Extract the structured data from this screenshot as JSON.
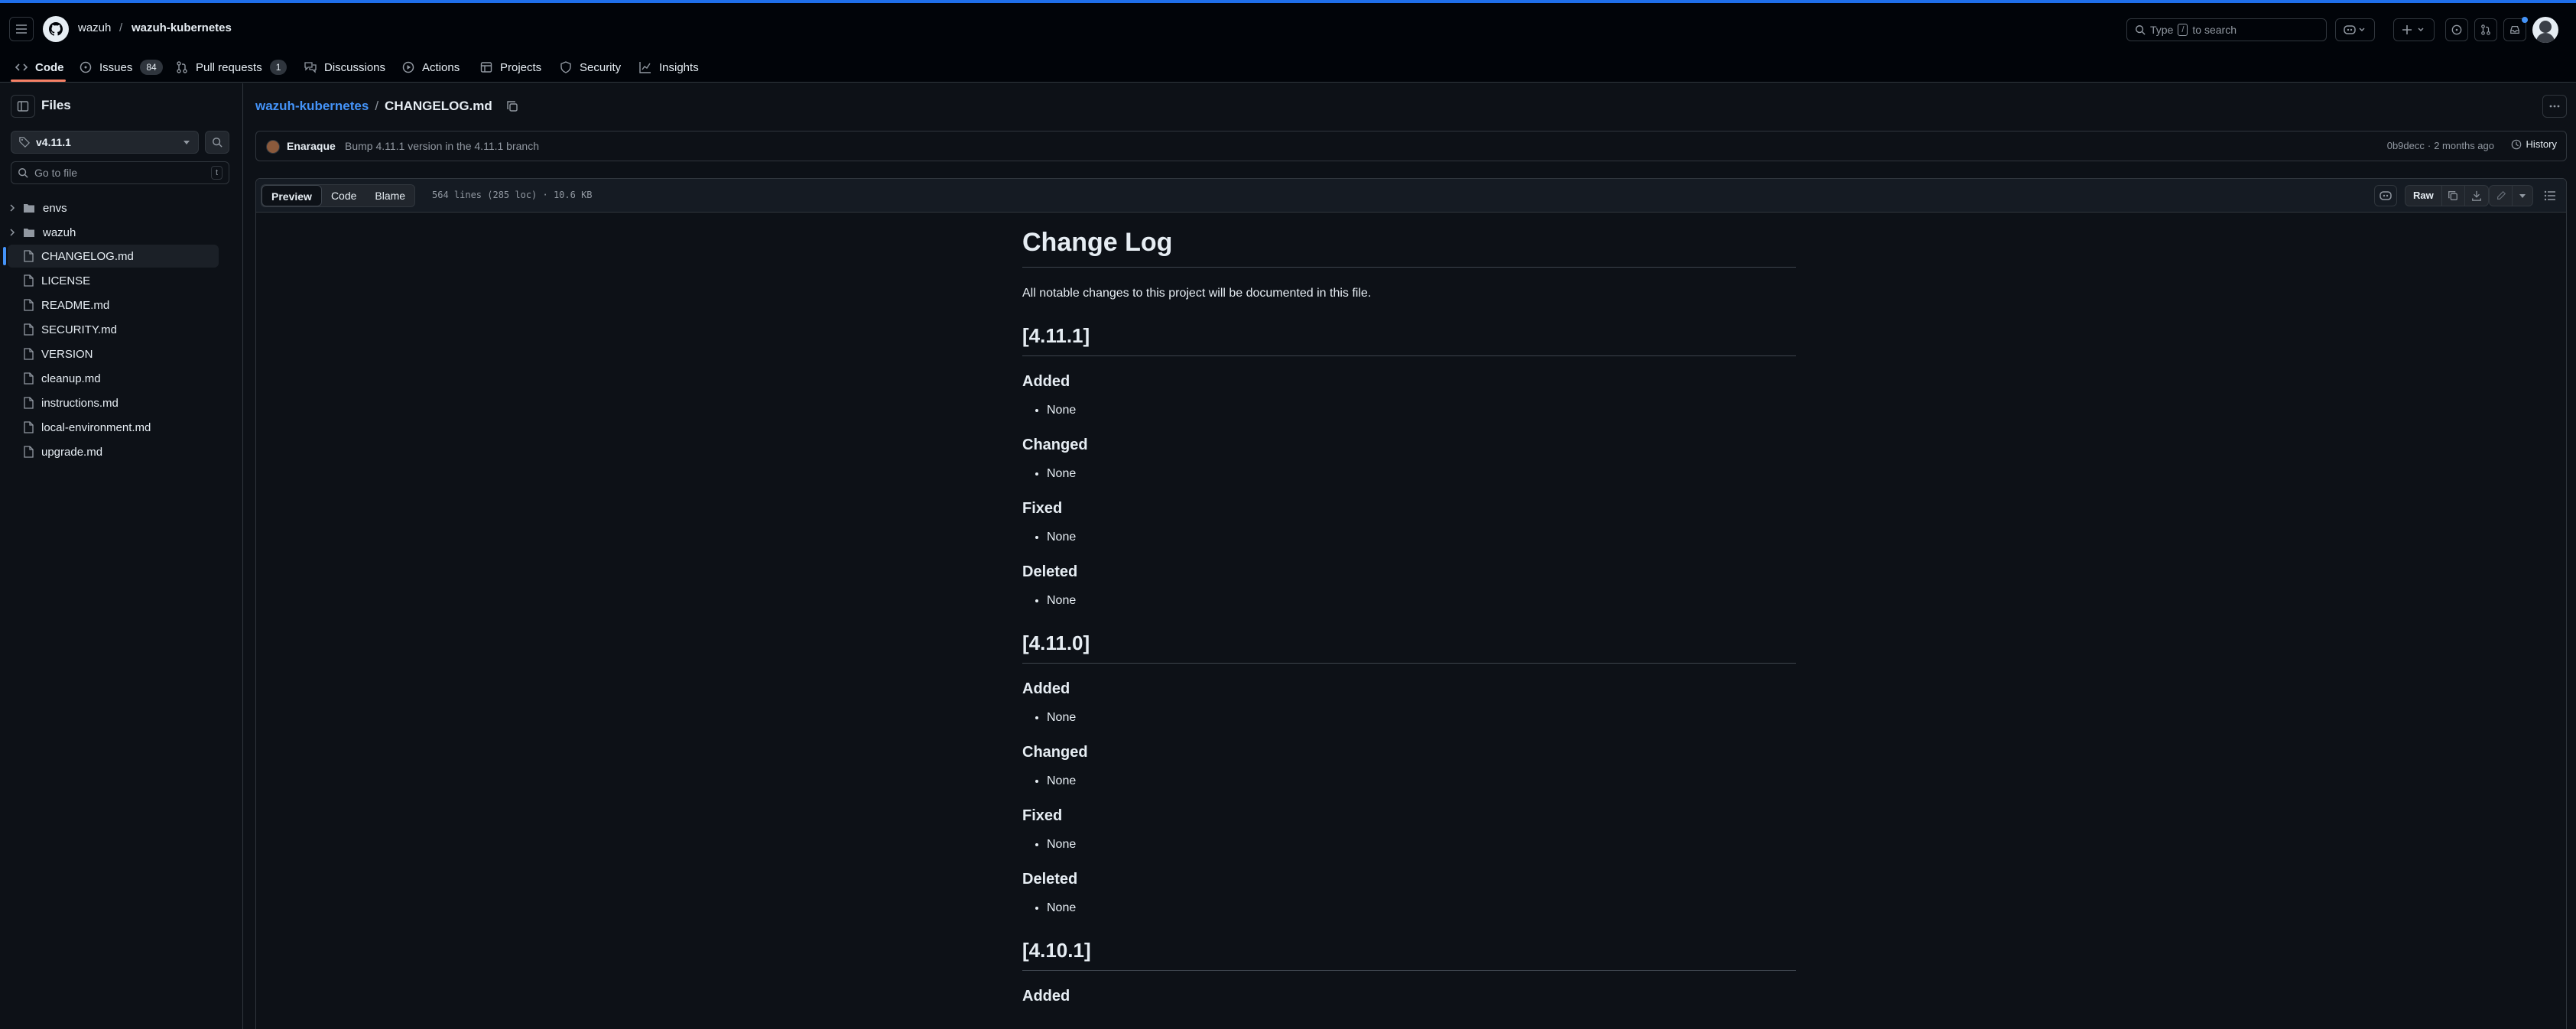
{
  "header": {
    "owner": "wazuh",
    "separator": "/",
    "repo": "wazuh-kubernetes",
    "search_placeholder_before": "Type",
    "search_key": "/",
    "search_placeholder_after": "to search"
  },
  "repo_nav": {
    "tabs": [
      {
        "label": "Code",
        "icon": "code-icon"
      },
      {
        "label": "Issues",
        "icon": "issue-icon",
        "count": "84"
      },
      {
        "label": "Pull requests",
        "icon": "pull-request-icon",
        "count": "1"
      },
      {
        "label": "Discussions",
        "icon": "discussion-icon"
      },
      {
        "label": "Actions",
        "icon": "play-icon"
      },
      {
        "label": "Projects",
        "icon": "table-icon"
      },
      {
        "label": "Security",
        "icon": "shield-icon"
      },
      {
        "label": "Insights",
        "icon": "graph-icon"
      }
    ]
  },
  "sidebar": {
    "title": "Files",
    "branch": "v4.11.1",
    "go_to_file_placeholder": "Go to file",
    "go_to_file_key": "t",
    "tree": [
      {
        "name": "envs",
        "type": "folder"
      },
      {
        "name": "wazuh",
        "type": "folder"
      },
      {
        "name": "CHANGELOG.md",
        "type": "file",
        "selected": true
      },
      {
        "name": "LICENSE",
        "type": "file"
      },
      {
        "name": "README.md",
        "type": "file"
      },
      {
        "name": "SECURITY.md",
        "type": "file"
      },
      {
        "name": "VERSION",
        "type": "file"
      },
      {
        "name": "cleanup.md",
        "type": "file"
      },
      {
        "name": "instructions.md",
        "type": "file"
      },
      {
        "name": "local-environment.md",
        "type": "file"
      },
      {
        "name": "upgrade.md",
        "type": "file"
      }
    ]
  },
  "breadcrumb": {
    "repo": "wazuh-kubernetes",
    "separator": "/",
    "file": "CHANGELOG.md"
  },
  "commit": {
    "author": "Enaraque",
    "message": "Bump 4.11.1 version in the 4.11.1 branch",
    "sha": "0b9decc",
    "dot": "·",
    "time": "2 months ago",
    "history_label": "History"
  },
  "file_toolbar": {
    "tabs": [
      "Preview",
      "Code",
      "Blame"
    ],
    "active_tab": "Preview",
    "meta": "564 lines (285 loc) · 10.6 KB",
    "raw_label": "Raw"
  },
  "markdown": {
    "title": "Change Log",
    "intro": "All notable changes to this project will be documented in this file.",
    "sections": [
      {
        "version": "[4.11.1]",
        "subsections": [
          {
            "heading": "Added",
            "items": [
              "None"
            ]
          },
          {
            "heading": "Changed",
            "items": [
              "None"
            ]
          },
          {
            "heading": "Fixed",
            "items": [
              "None"
            ]
          },
          {
            "heading": "Deleted",
            "items": [
              "None"
            ]
          }
        ]
      },
      {
        "version": "[4.11.0]",
        "subsections": [
          {
            "heading": "Added",
            "items": [
              "None"
            ]
          },
          {
            "heading": "Changed",
            "items": [
              "None"
            ]
          },
          {
            "heading": "Fixed",
            "items": [
              "None"
            ]
          },
          {
            "heading": "Deleted",
            "items": [
              "None"
            ]
          }
        ]
      },
      {
        "version": "[4.10.1]",
        "subsections": [
          {
            "heading": "Added",
            "items": []
          }
        ]
      }
    ]
  },
  "colors": {
    "background": "#0d1117",
    "header_background": "#010409",
    "accent_link": "#4493f8",
    "active_tab_underline": "#f78166",
    "border": "#30363d"
  }
}
